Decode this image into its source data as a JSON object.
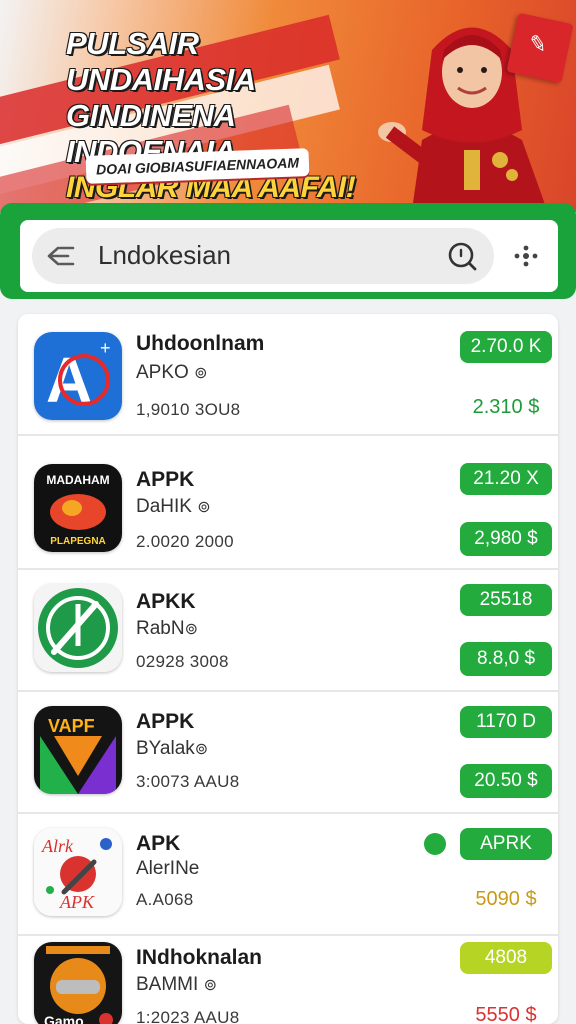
{
  "banner": {
    "title_line1": "PULSAIR UNDAIHASIA",
    "title_line2": "GINDINENA INDOENAIA",
    "title_line3": "INGLAR MAA AAFAI!",
    "tag": "DOAI GIOBIASUFIAENNAOAM"
  },
  "search": {
    "value": "Lndokesian",
    "icons": {
      "back": "back-arrow-icon",
      "search": "search-icon",
      "more": "more-icon"
    }
  },
  "colors": {
    "accent": "#23ab3e",
    "price_red": "#d9322f",
    "price_gold": "#c89a16",
    "lime": "#b5d424"
  },
  "apps": [
    {
      "name": "Uhdoonlnam",
      "sub": "APKO",
      "meta": "1,9010  3OU8",
      "size": "2.70.0 K",
      "price": "2.310 $"
    },
    {
      "name": "APPK",
      "sub": "DaHIK",
      "meta": "2.0020  2000",
      "size": "21.20 X",
      "price": "2,980 $"
    },
    {
      "name": "APKK",
      "sub": "RabN",
      "meta": "02928  3008",
      "size": "25518",
      "price": "8.8,0 $"
    },
    {
      "name": "APPK",
      "sub": "BYalak",
      "meta": "3:0073  AAU8",
      "size": "1170 D",
      "price": "20.50 $"
    },
    {
      "name": "APK",
      "sub": "AlerINe",
      "meta": "A.A068",
      "size": "APRK",
      "price": "5090 $"
    },
    {
      "name": "INdhoknalan",
      "sub": "BAMMI",
      "meta": "1:2023  AAU8",
      "size": "4808",
      "price": "5550 $"
    }
  ],
  "icon_labels": {
    "app1": "A",
    "app1_badge": "+",
    "app2_top": "MADAHAM",
    "app2_bottom": "PLAPEGNA",
    "app4": "VAPF",
    "app5_top": "Alrk",
    "app5_bottom": "APK",
    "app6_bottom": "Gamo"
  }
}
